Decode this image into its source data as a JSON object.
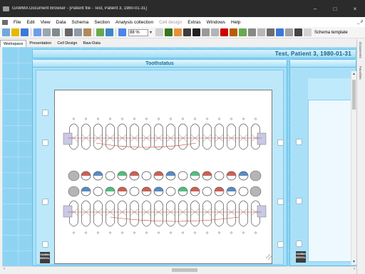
{
  "window": {
    "title": "GAMMA Document Browser - [Patient file - Test, Patient 3, 1980-01-31]",
    "controls": [
      "–",
      "□",
      "×"
    ]
  },
  "menu": {
    "items": [
      "File",
      "Edit",
      "View",
      "Data",
      "Schema",
      "Section",
      "Analysis collection",
      "Cell design",
      "Extras",
      "Windows",
      "Help"
    ],
    "disabled": [
      "Cell design"
    ],
    "right_controls": "_ ∂"
  },
  "toolbar": {
    "zoom_value": "88 %",
    "schema_label": "Schema template",
    "icons": [
      {
        "name": "new-icon",
        "color": "#6fa8dc"
      },
      {
        "name": "open-icon",
        "color": "#e6b800"
      },
      {
        "name": "save-icon",
        "color": "#3c78d8"
      },
      {
        "name": "save-as-icon",
        "color": "#6d9eeb"
      },
      {
        "name": "print-preview-icon",
        "color": "#9aa5b1"
      },
      {
        "name": "print-icon",
        "color": "#7f8c8d"
      },
      {
        "name": "cut-icon",
        "color": "#666666"
      },
      {
        "name": "copy-icon",
        "color": "#8e9aa6"
      },
      {
        "name": "paste-icon",
        "color": "#b08a5a"
      },
      {
        "name": "image-icon",
        "color": "#6aa84f"
      },
      {
        "name": "info-icon",
        "color": "#3d85c6"
      },
      {
        "name": "zoom-icon",
        "color": "#4a86e8"
      },
      {
        "name": "close-x-icon",
        "color": "#d0d0d0"
      },
      {
        "name": "chart-icon",
        "color": "#38761d"
      },
      {
        "name": "sound-icon",
        "color": "#e69138"
      },
      {
        "name": "grid-icon",
        "color": "#3d3d3d"
      },
      {
        "name": "globe-icon",
        "color": "#222222"
      },
      {
        "name": "table-icon",
        "color": "#999999"
      },
      {
        "name": "dna-icon",
        "color": "#b4b4b4"
      },
      {
        "name": "ruler-icon",
        "color": "#cc0000"
      },
      {
        "name": "plot-icon",
        "color": "#b45f06"
      },
      {
        "name": "dots-icon",
        "color": "#6aa84f"
      },
      {
        "name": "tooth-icon",
        "color": "#888888"
      },
      {
        "name": "drop-icon",
        "color": "#b7b7b7"
      },
      {
        "name": "photo-icon",
        "color": "#6d6d6d"
      },
      {
        "name": "screen-icon",
        "color": "#3c78d8"
      },
      {
        "name": "frame-icon",
        "color": "#a0a0a0"
      },
      {
        "name": "export-icon",
        "color": "#444444"
      },
      {
        "name": "template-icon",
        "color": "#d3d3d3"
      }
    ]
  },
  "tabs": [
    "Workspace",
    "Presentation",
    "Cell Design",
    "Raw-Data"
  ],
  "active_tab": "Workspace",
  "patient": {
    "name": "Test, Patient 3, 1980-01-31"
  },
  "panel": {
    "title": "Toothstatus"
  },
  "logo": {
    "line1": "GAMMA",
    "line2": "DENTAL"
  },
  "colors": {
    "workspace_bg": "#8fd3f2",
    "panel_header_text": "#1f6b93",
    "patient_text": "#1b5f84",
    "tooth_stroke": "#555555",
    "marker_red": "#c0392b",
    "marker_green": "#27ae60",
    "marker_blue": "#2e6fb5",
    "marker_orange": "#e67e22"
  },
  "side_labels": [
    "Documents",
    "Favorites"
  ]
}
